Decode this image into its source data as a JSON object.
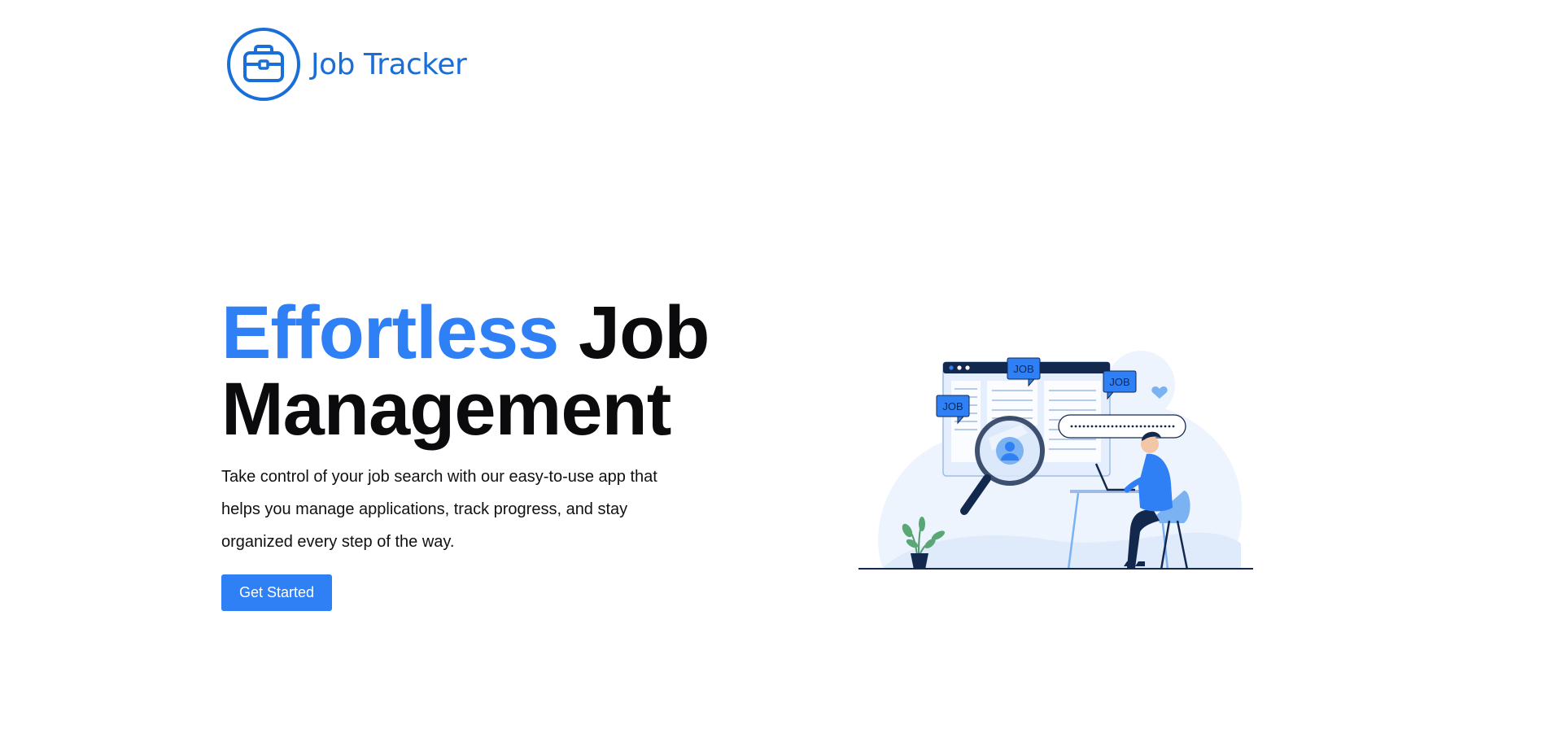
{
  "brand": {
    "name": "Job Tracker",
    "icon": "briefcase-icon",
    "color": "#1a6ed8"
  },
  "hero": {
    "title_accent": "Effortless",
    "title_rest_line1": "Job",
    "title_line2": "Management",
    "accent_color": "#2f80f5",
    "description": "Take control of your job search with our easy-to-use app that helps you manage applications, track progress, and stay organized every step of the way.",
    "cta_label": "Get Started"
  },
  "illustration": {
    "job_tags": [
      "JOB",
      "JOB",
      "JOB"
    ],
    "colors": {
      "primary": "#2f80f5",
      "light": "#dbe8fb",
      "dark": "#13284d"
    }
  }
}
